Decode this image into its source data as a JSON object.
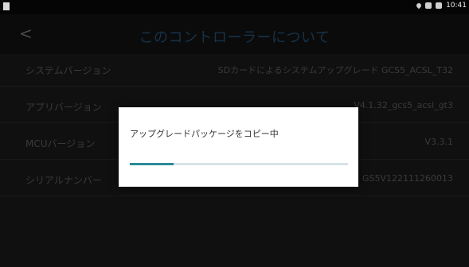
{
  "statusbar": {
    "time": "10:41"
  },
  "header": {
    "back_glyph": "<",
    "title": "このコントローラーについて"
  },
  "rows": [
    {
      "label": "システムバージョン",
      "value": "SDカードによるシステムアップグレード  GCS5_ACSL_T32"
    },
    {
      "label": "アプリバージョン",
      "value": "V4.1.32_gcs5_acsl_gt3"
    },
    {
      "label": "MCUバージョン",
      "value": "V3.3.1"
    },
    {
      "label": "シリアルナンバー",
      "value": "GS5V122111260013"
    }
  ],
  "dialog": {
    "message": "アップグレードパッケージをコピー中",
    "progress": 0.2
  },
  "colors": {
    "progress_fill": "#2a8a9c",
    "progress_track": "#d6e2e6",
    "title": "#17334a"
  },
  "icons": {
    "status_left": "sim-card-icon",
    "status_right": [
      "location-pin-icon",
      "signal-icon",
      "battery-icon"
    ]
  }
}
